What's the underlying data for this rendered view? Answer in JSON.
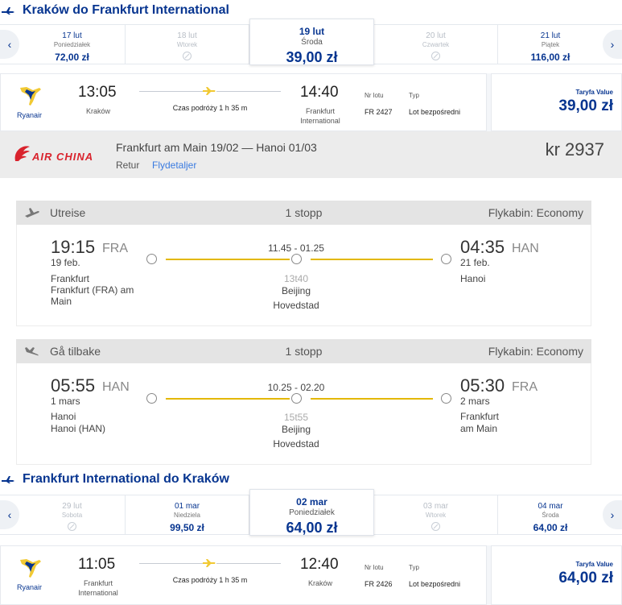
{
  "outbound": {
    "title": "Kraków do Frankfurt International",
    "dates": [
      {
        "date": "17 lut",
        "weekday": "Poniedziałek",
        "price": "72,00 zł",
        "available": true,
        "active": false
      },
      {
        "date": "18 lut",
        "weekday": "Wtorek",
        "price": "",
        "available": false,
        "active": false
      },
      {
        "date": "19 lut",
        "weekday": "Środa",
        "price": "39,00 zł",
        "available": true,
        "active": true
      },
      {
        "date": "20 lut",
        "weekday": "Czwartek",
        "price": "",
        "available": false,
        "active": false
      },
      {
        "date": "21 lut",
        "weekday": "Piątek",
        "price": "116,00 zł",
        "available": true,
        "active": false
      }
    ],
    "flight": {
      "airline": "Ryanair",
      "depart_time": "13:05",
      "depart_city": "Kraków",
      "duration": "Czas podróży 1 h 35 m",
      "arrive_time": "14:40",
      "arrive_city_line1": "Frankfurt",
      "arrive_city_line2": "International",
      "flight_no_label": "Nr lotu",
      "flight_no": "FR 2427",
      "type_label": "Typ",
      "type": "Lot bezpośredni",
      "fare_label": "Taryfa Value",
      "fare": "39,00 zł"
    }
  },
  "airchina": {
    "logo_text": "AIR CHINA",
    "route": "Frankfurt am Main 19/02 — Hanoi 01/03",
    "trip_type": "Retur",
    "details_link": "Flydetaljer",
    "price": "kr 2937",
    "legs": [
      {
        "label": "Utreise",
        "stops": "1 stopp",
        "cabin": "Flykabin: Economy",
        "dep_time": "19:15",
        "dep_code": "FRA",
        "dep_date": "19 feb.",
        "dep_city": "Frankfurt",
        "dep_airport_line1": "Frankfurt (FRA) am",
        "dep_airport_line2": "Main",
        "layover_times": "11.45 - 01.25",
        "layover_duration": "13t40",
        "layover_city": "Beijing",
        "layover_airport": "Hovedstad",
        "arr_time": "04:35",
        "arr_code": "HAN",
        "arr_date": "21 feb.",
        "arr_city": "Hanoi",
        "arr_airport_line1": "",
        "arr_airport_line2": ""
      },
      {
        "label": "Gå tilbake",
        "stops": "1 stopp",
        "cabin": "Flykabin: Economy",
        "dep_time": "05:55",
        "dep_code": "HAN",
        "dep_date": "1 mars",
        "dep_city": "Hanoi",
        "dep_airport_line1": "Hanoi (HAN)",
        "dep_airport_line2": "",
        "layover_times": "10.25 - 02.20",
        "layover_duration": "15t55",
        "layover_city": "Beijing",
        "layover_airport": "Hovedstad",
        "arr_time": "05:30",
        "arr_code": "FRA",
        "arr_date": "2 mars",
        "arr_city": "Frankfurt",
        "arr_airport_line1": "am Main",
        "arr_airport_line2": ""
      }
    ]
  },
  "inbound": {
    "title": "Frankfurt International do Kraków",
    "dates": [
      {
        "date": "29 lut",
        "weekday": "Sobota",
        "price": "",
        "available": false,
        "active": false
      },
      {
        "date": "01 mar",
        "weekday": "Niedziela",
        "price": "99,50 zł",
        "available": true,
        "active": false
      },
      {
        "date": "02 mar",
        "weekday": "Poniedziałek",
        "price": "64,00 zł",
        "available": true,
        "active": true
      },
      {
        "date": "03 mar",
        "weekday": "Wtorek",
        "price": "",
        "available": false,
        "active": false
      },
      {
        "date": "04 mar",
        "weekday": "Środa",
        "price": "64,00 zł",
        "available": true,
        "active": false
      }
    ],
    "flight": {
      "airline": "Ryanair",
      "depart_time": "11:05",
      "depart_city_line1": "Frankfurt",
      "depart_city_line2": "International",
      "duration": "Czas podróży 1 h 35 m",
      "arrive_time": "12:40",
      "arrive_city": "Kraków",
      "flight_no_label": "Nr lotu",
      "flight_no": "FR 2426",
      "type_label": "Typ",
      "type": "Lot bezpośredni",
      "fare_label": "Taryfa Value",
      "fare": "64,00 zł"
    }
  },
  "colors": {
    "ryanair_blue": "#073590",
    "ryanair_yellow": "#f1c933",
    "airchina_red": "#d9232d",
    "route_line": "#e3b800",
    "link_blue": "#3a7be0"
  }
}
